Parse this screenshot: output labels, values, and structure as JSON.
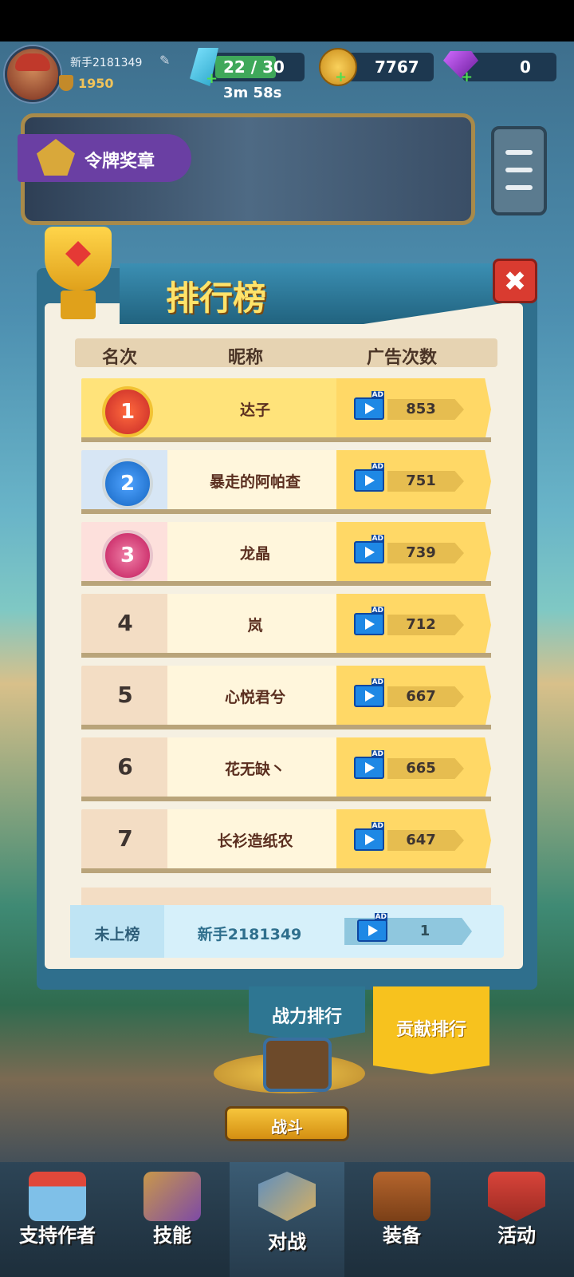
{
  "player": {
    "name": "新手2181349",
    "power": "1950"
  },
  "resources": {
    "energy": "22 / 30",
    "timer": "3m 58s",
    "coins": "7767",
    "gems": "0"
  },
  "banner": {
    "medal_label": "令牌奖章"
  },
  "leaderboard": {
    "title": "排行榜",
    "columns": {
      "rank": "名次",
      "nickname": "昵称",
      "ad_count": "广告次数"
    },
    "rows": [
      {
        "rank": "1",
        "name": "达子",
        "count": "853"
      },
      {
        "rank": "2",
        "name": "暴走的阿帕查",
        "count": "751"
      },
      {
        "rank": "3",
        "name": "龙晶",
        "count": "739"
      },
      {
        "rank": "4",
        "name": "岚",
        "count": "712"
      },
      {
        "rank": "5",
        "name": "心悦君兮",
        "count": "667"
      },
      {
        "rank": "6",
        "name": "花无缺丶",
        "count": "665"
      },
      {
        "rank": "7",
        "name": "长衫造纸农",
        "count": "647"
      }
    ],
    "self": {
      "rank": "未上榜",
      "name": "新手2181349",
      "count": "1"
    },
    "ad_badge": "AD",
    "close": "✖"
  },
  "tabs": {
    "power": "战力排行",
    "contribution": "贡献排行"
  },
  "battle_button": "战斗",
  "nav": [
    {
      "label": "支持作者",
      "icon": "shop-icon"
    },
    {
      "label": "技能",
      "icon": "skill-icon"
    },
    {
      "label": "对战",
      "icon": "battle-icon"
    },
    {
      "label": "装备",
      "icon": "backpack-icon"
    },
    {
      "label": "活动",
      "icon": "event-icon"
    }
  ]
}
